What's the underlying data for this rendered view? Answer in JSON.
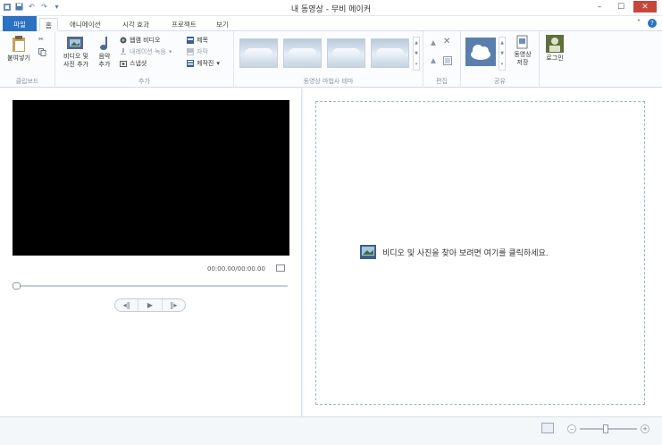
{
  "window": {
    "title": "내 동영상 - 무비 메이커",
    "minimize_icon": "minimize-icon",
    "maximize_icon": "maximize-icon",
    "close_icon": "close-icon"
  },
  "tabs": {
    "file": "파일",
    "home": "홈",
    "animation": "애니메이션",
    "visual_effects": "시각 효과",
    "project": "프로젝트",
    "view": "보기"
  },
  "ribbon": {
    "clipboard": {
      "label": "클립보드",
      "paste": "붙여넣기"
    },
    "add": {
      "label": "추가",
      "add_media_line1": "비디오 및",
      "add_media_line2": "사진 추가",
      "music_line1": "음악",
      "music_line2": "추가",
      "webcam": "웹캠 비디오",
      "narration": "내레이션 녹음",
      "snapshot": "스냅샷",
      "title": "제목",
      "caption": "자막",
      "credits": "제작진"
    },
    "themes": {
      "label": "동영상 마법사 테마"
    },
    "editing": {
      "label": "편집"
    },
    "share": {
      "label": "공유",
      "save_line1": "동영상",
      "save_line2": "저장"
    },
    "signin": {
      "label": "로그인"
    }
  },
  "preview": {
    "timecode": "00:00.00/00:00.00"
  },
  "storyboard": {
    "message": "비디오 및 사진을 찾아 보려면 여기를 클릭하세요."
  },
  "colors": {
    "accent": "#2b72c2",
    "close": "#c8453a",
    "storyboard_border": "#9ab4d2"
  }
}
